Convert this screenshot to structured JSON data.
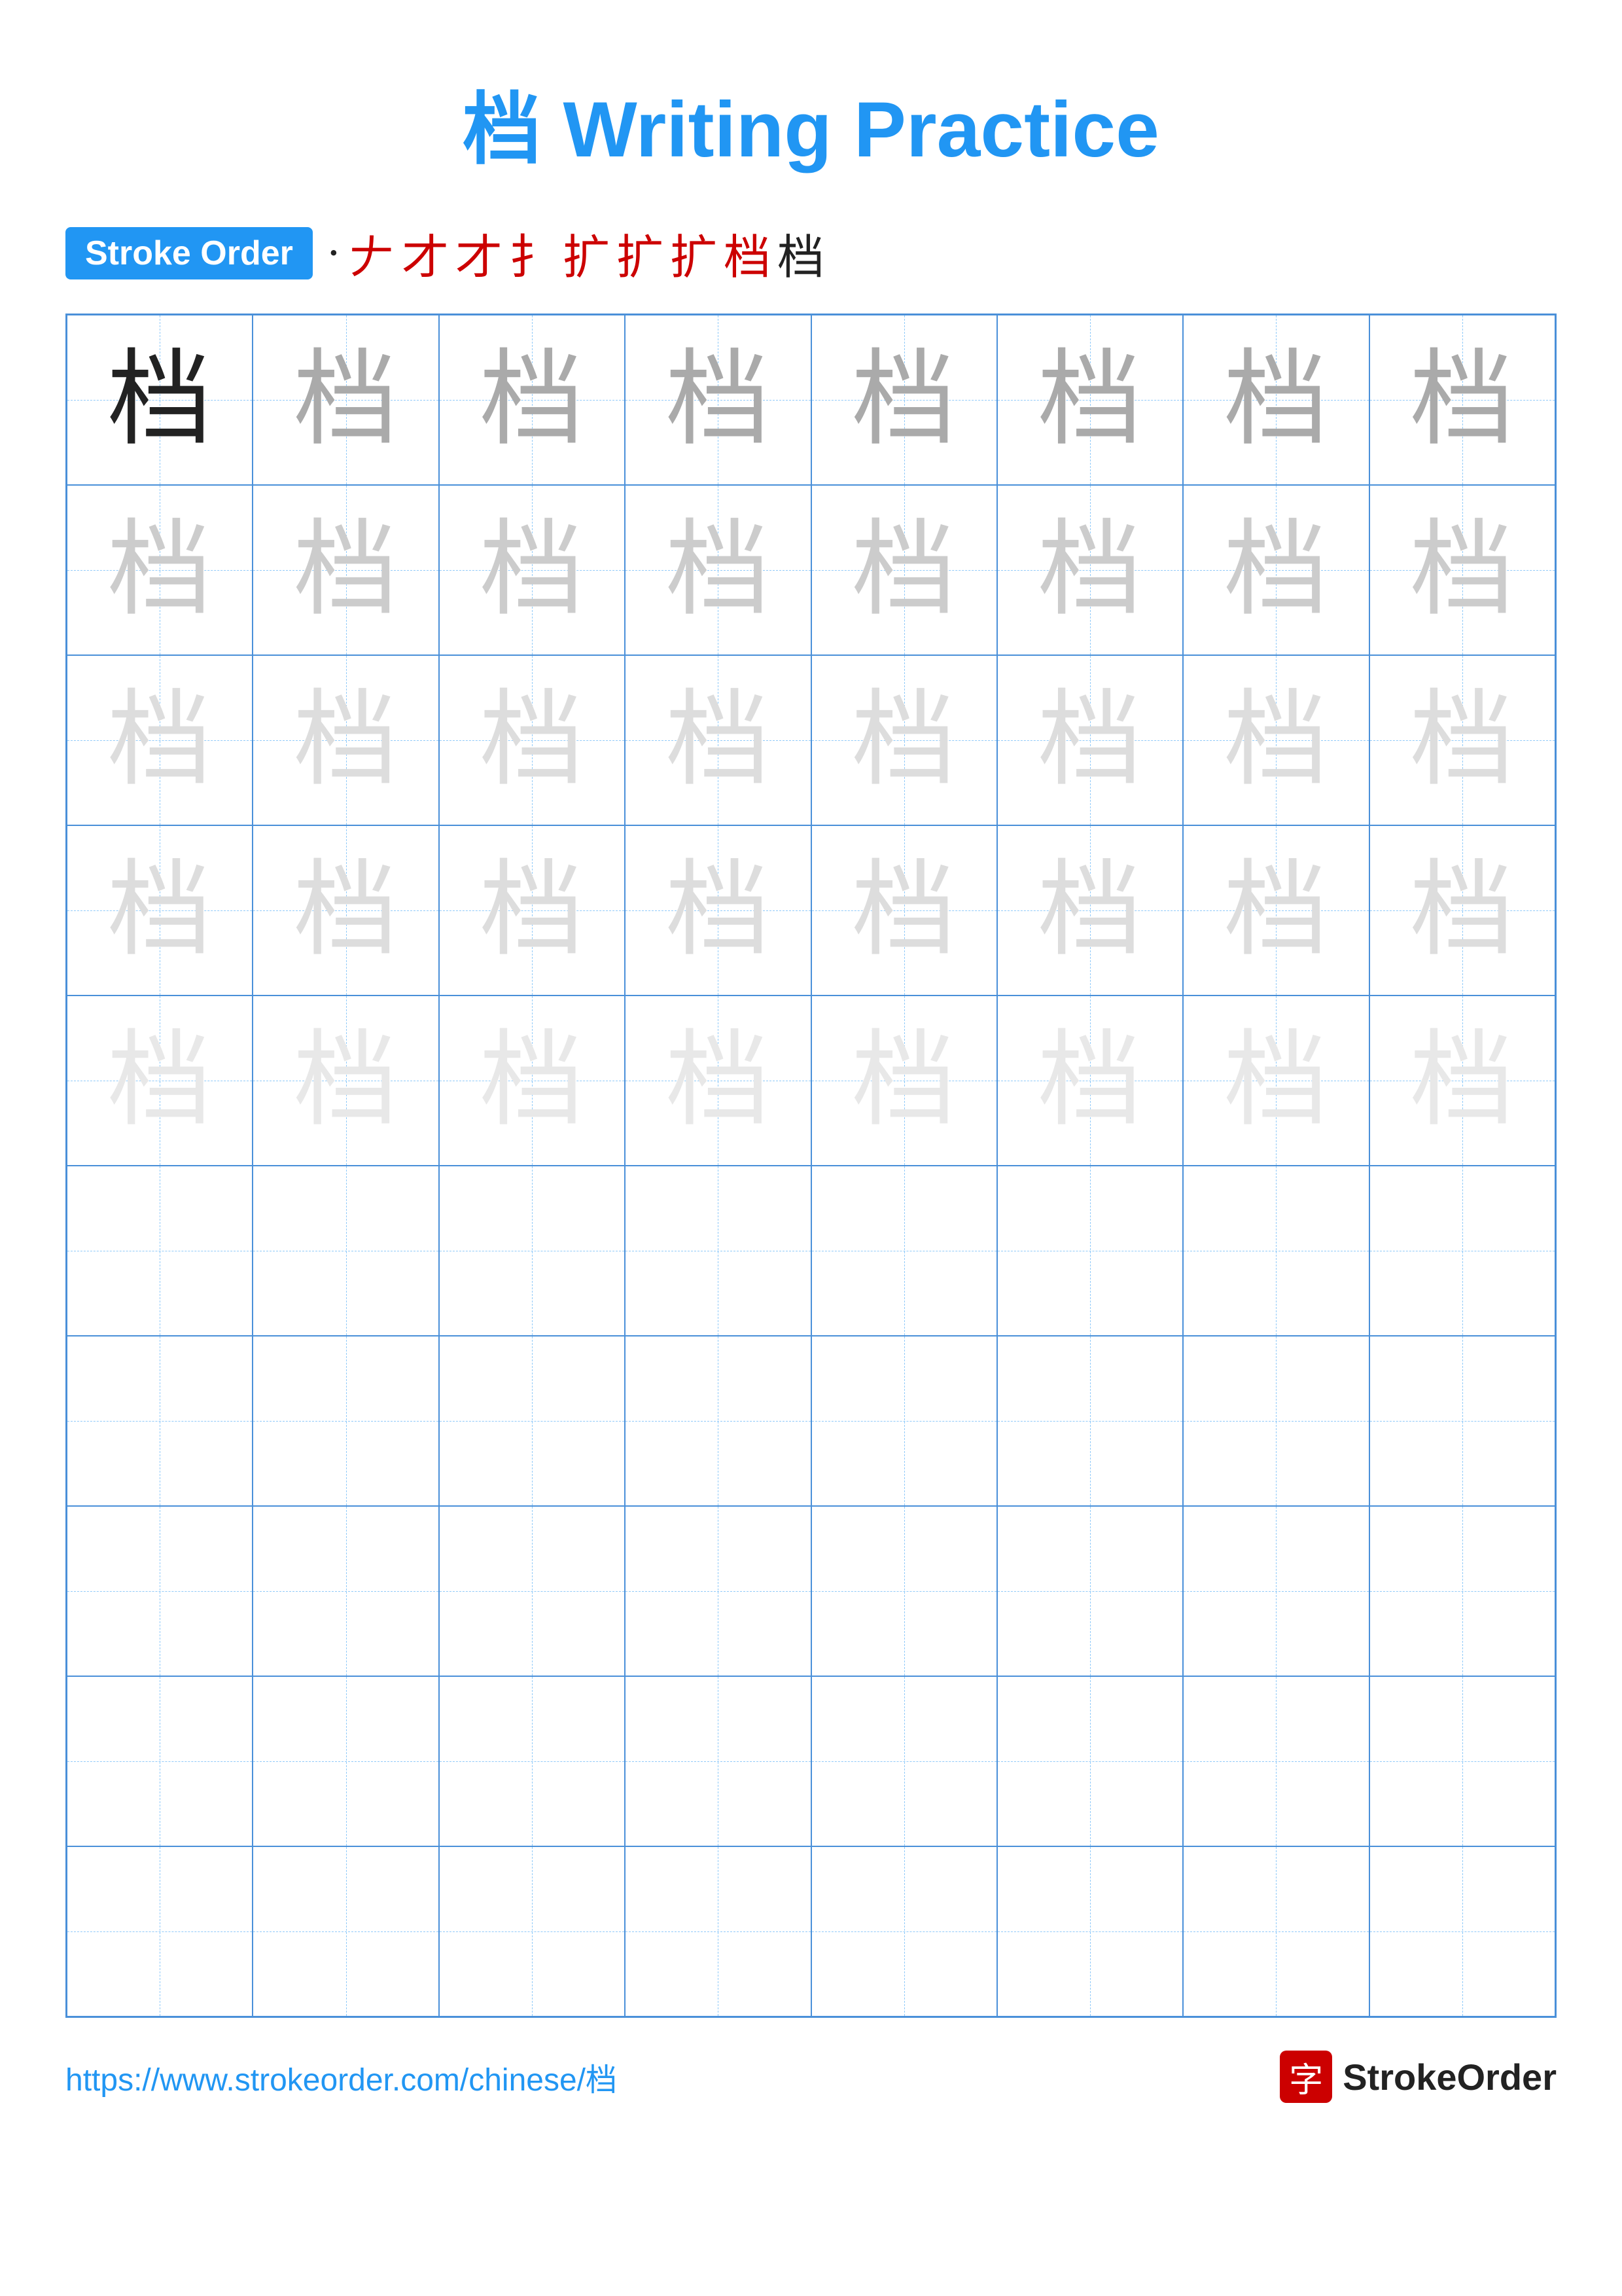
{
  "page": {
    "title": "档 Writing Practice",
    "title_char": "档",
    "title_suffix": " Writing Practice"
  },
  "stroke_order": {
    "badge_label": "Stroke Order",
    "sequence": [
      "·",
      "𠂇",
      "才",
      "才",
      "扌",
      "扩",
      "扩",
      "扩",
      "档",
      "档"
    ]
  },
  "grid": {
    "rows": 10,
    "cols": 8,
    "char": "档",
    "filled_rows": 5,
    "row_styles": [
      "dark",
      "medium",
      "light",
      "lighter",
      "lighter"
    ]
  },
  "footer": {
    "url": "https://www.strokeorder.com/chinese/档",
    "logo_char": "字",
    "logo_text": "StrokeOrder"
  }
}
